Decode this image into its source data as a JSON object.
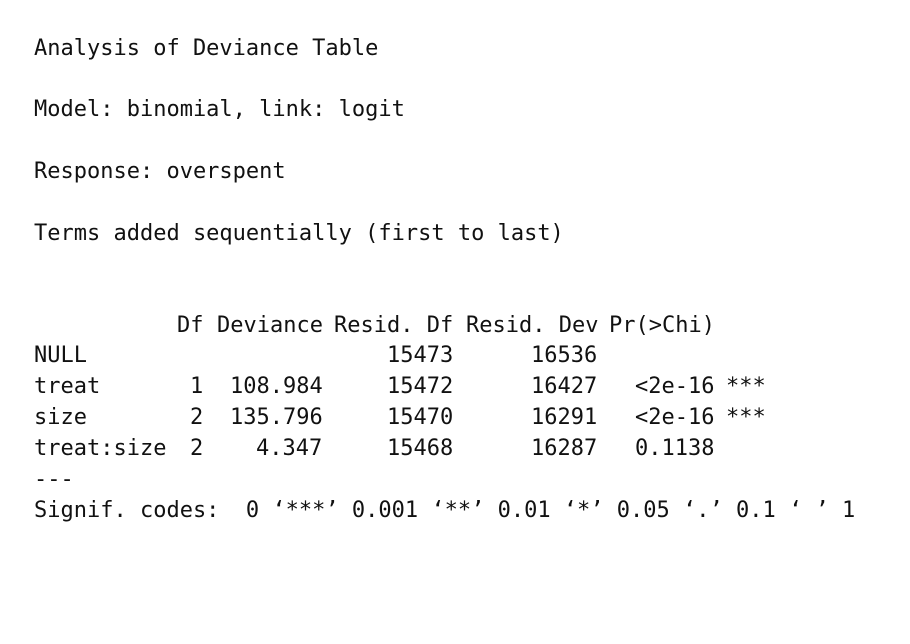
{
  "output": {
    "title": "Analysis of Deviance Table",
    "model": "Model: binomial, link: logit",
    "response": "Response: overspent",
    "terms": "Terms added sequentially (first to last)",
    "table": {
      "headers": [
        "Df",
        "Deviance",
        "Resid. Df",
        "Resid. Dev",
        "Pr(>Chi)"
      ],
      "rows": [
        {
          "term": "NULL",
          "df": "",
          "deviance": "",
          "resid_df": "15473",
          "resid_dev": "16536",
          "pval": "",
          "signif": ""
        },
        {
          "term": "treat",
          "df": "1",
          "deviance": "108.984",
          "resid_df": "15472",
          "resid_dev": "16427",
          "pval": "<2e-16",
          "signif": "***"
        },
        {
          "term": "size",
          "df": "2",
          "deviance": "135.796",
          "resid_df": "15470",
          "resid_dev": "16291",
          "pval": "<2e-16",
          "signif": "***"
        },
        {
          "term": "treat:size",
          "df": "2",
          "deviance": "4.347",
          "resid_df": "15468",
          "resid_dev": "16287",
          "pval": "0.1138",
          "signif": ""
        }
      ]
    },
    "separator": "---",
    "signif_codes": "Signif. codes:  0 ‘***’ 0.001 ‘**’ 0.01 ‘*’ 0.05 ‘.’ 0.1 ‘ ’ 1"
  }
}
